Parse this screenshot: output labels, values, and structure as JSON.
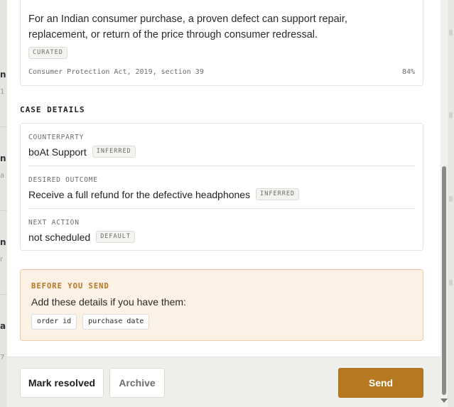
{
  "claim": {
    "text": "For an Indian consumer purchase, a proven defect can support repair, replacement, or return of the price through consumer redressal.",
    "tag": "CURATED",
    "citation": "Consumer Protection Act, 2019, section 39",
    "confidence": "84%"
  },
  "case_details": {
    "title": "CASE DETAILS",
    "fields": [
      {
        "label": "COUNTERPARTY",
        "value": "boAt Support",
        "tag": "INFERRED"
      },
      {
        "label": "DESIRED OUTCOME",
        "value": "Receive a full refund for the defective headphones",
        "tag": "INFERRED"
      },
      {
        "label": "NEXT ACTION",
        "value": "not scheduled",
        "tag": "DEFAULT"
      }
    ]
  },
  "before_send": {
    "title": "BEFORE YOU SEND",
    "text": "Add these details if you have them:",
    "missing": [
      "order id",
      "purchase date"
    ]
  },
  "footer": {
    "mark_resolved": "Mark resolved",
    "archive": "Archive",
    "send": "Send"
  },
  "colors": {
    "accent": "#b7791f",
    "warning_bg": "#fbf1e4",
    "warning_border": "#e8c9a4"
  }
}
